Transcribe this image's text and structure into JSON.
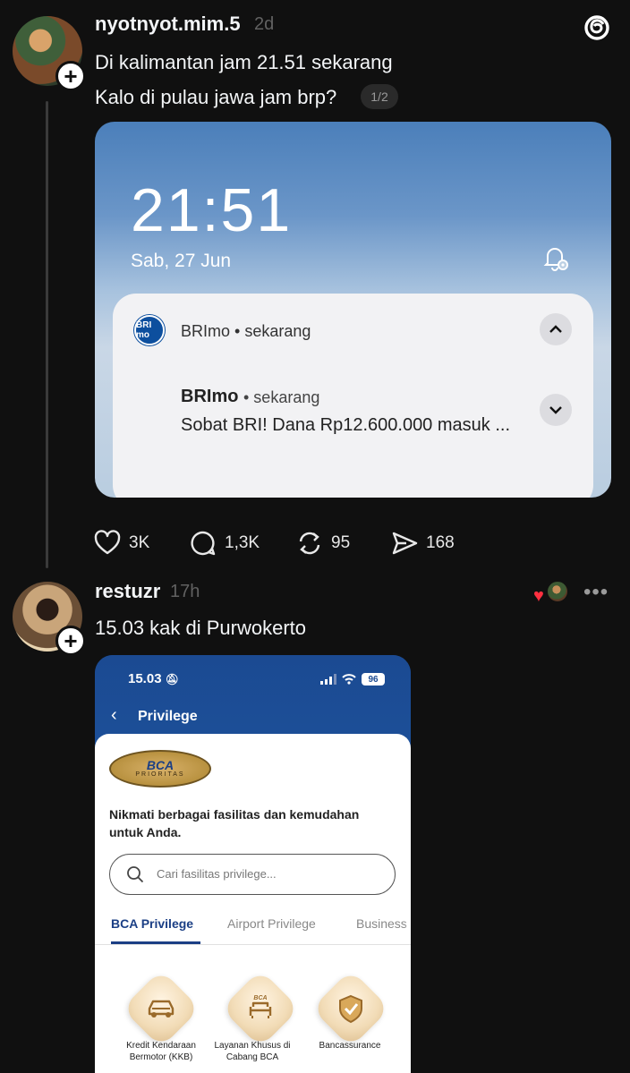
{
  "post1": {
    "username": "nyotnyot.mim.5",
    "time": "2d",
    "line1": "Di kalimantan jam 21.51 sekarang",
    "line2": "Kalo di pulau jawa jam brp?",
    "page_indicator": "1/2",
    "image": {
      "lock_time": "21:51",
      "lock_date": "Sab, 27 Jun",
      "notif_app": "BRImo",
      "notif_header_time": "• sekarang",
      "notif_logo_text": "BRI mo",
      "notif_title": "BRImo",
      "notif_time": "• sekarang",
      "notif_message": "Sobat BRI! Dana Rp12.600.000 masuk ..."
    },
    "actions": {
      "likes": "3K",
      "replies": "1,3K",
      "reposts": "95",
      "shares": "168"
    }
  },
  "post2": {
    "username": "restuzr",
    "time": "17h",
    "text": "15.03 kak di Purwokerto",
    "image": {
      "status_time": "15.03",
      "battery": "96",
      "title": "Privilege",
      "logo_main": "BCA",
      "logo_sub": "PRIORITAS",
      "description": "Nikmati berbagai fasilitas dan kemudahan untuk Anda.",
      "search_placeholder": "Cari fasilitas privilege...",
      "tabs": [
        "BCA Privilege",
        "Airport Privilege",
        "Business"
      ],
      "items": [
        {
          "label": "Kredit Kendaraan Bermotor (KKB)",
          "icon": "car-icon"
        },
        {
          "label": "Layanan Khusus di Cabang BCA",
          "icon": "sofa-icon"
        },
        {
          "label": "Bancassurance",
          "icon": "shield-check-icon"
        }
      ]
    }
  },
  "colors": {
    "background": "#101010",
    "bca_blue": "#1b4a92",
    "heart_red": "#ff3040"
  }
}
